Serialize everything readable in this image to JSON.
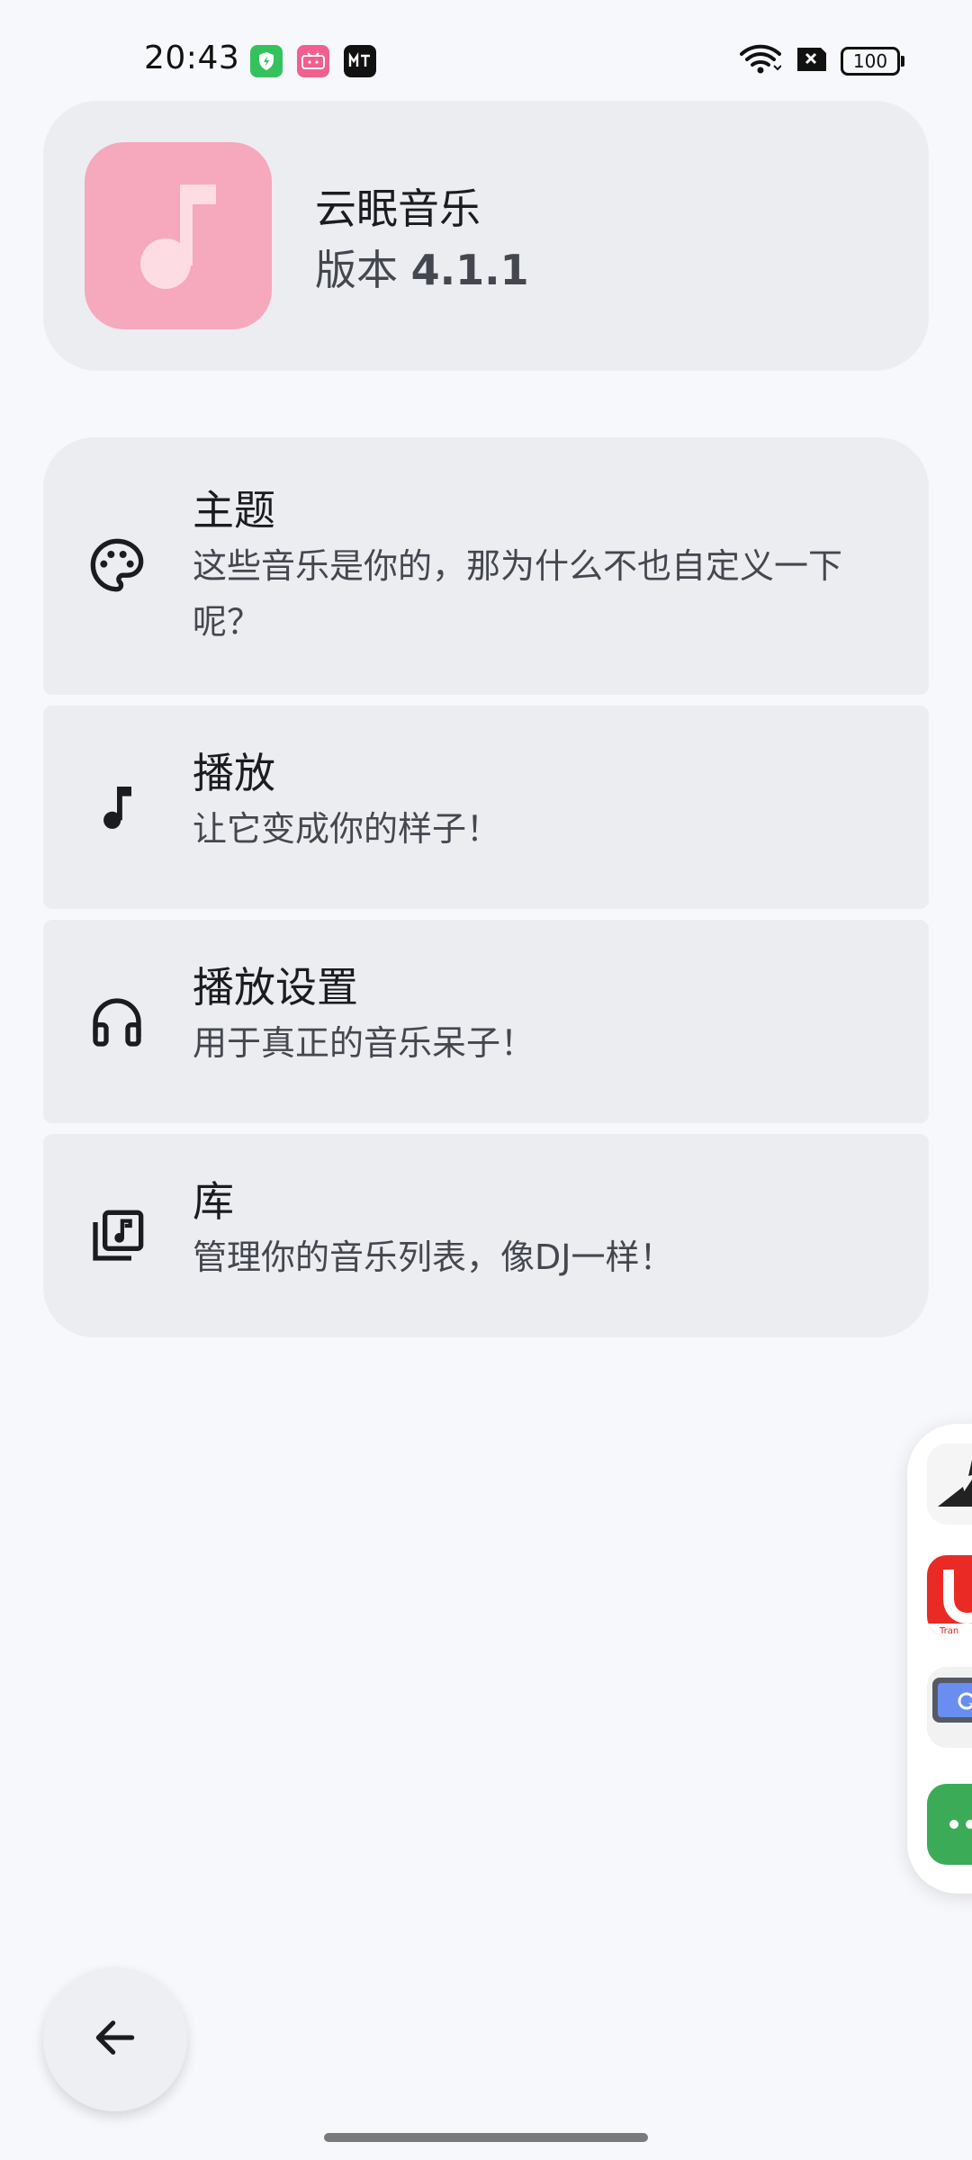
{
  "status_bar": {
    "time": "20:43",
    "battery": "100",
    "notification_icons": [
      "security-shield-icon",
      "bilibili-icon",
      "mt-manager-icon"
    ],
    "system_icons": [
      "wifi-icon",
      "sim-disabled-icon",
      "battery-icon"
    ]
  },
  "app_info": {
    "name": "云眠音乐",
    "version_label": "版本",
    "version_number": "4.1.1",
    "icon": "music-note-icon",
    "icon_bg": "#f6a8bc"
  },
  "settings": {
    "items": [
      {
        "icon": "palette-icon",
        "title": "主题",
        "subtitle": "这些音乐是你的，那为什么不也自定义一下呢？"
      },
      {
        "icon": "music-note-icon",
        "title": "播放",
        "subtitle": "让它变成你的样子！"
      },
      {
        "icon": "headphones-icon",
        "title": "播放设置",
        "subtitle": "用于真正的音乐呆子！"
      },
      {
        "icon": "music-library-icon",
        "title": "库",
        "subtitle": "管理你的音乐列表，像DJ一样！"
      }
    ]
  },
  "side_dock": {
    "apps": [
      "dock-app-1",
      "translate-app-icon",
      "screen-tool-app-icon",
      "messaging-app-icon"
    ]
  },
  "navigation": {
    "back_icon": "arrow-back-icon"
  },
  "colors": {
    "background": "#f7f8fc",
    "card": "#ecedf1",
    "text_primary": "#1b1c20",
    "text_secondary": "#44474f"
  }
}
